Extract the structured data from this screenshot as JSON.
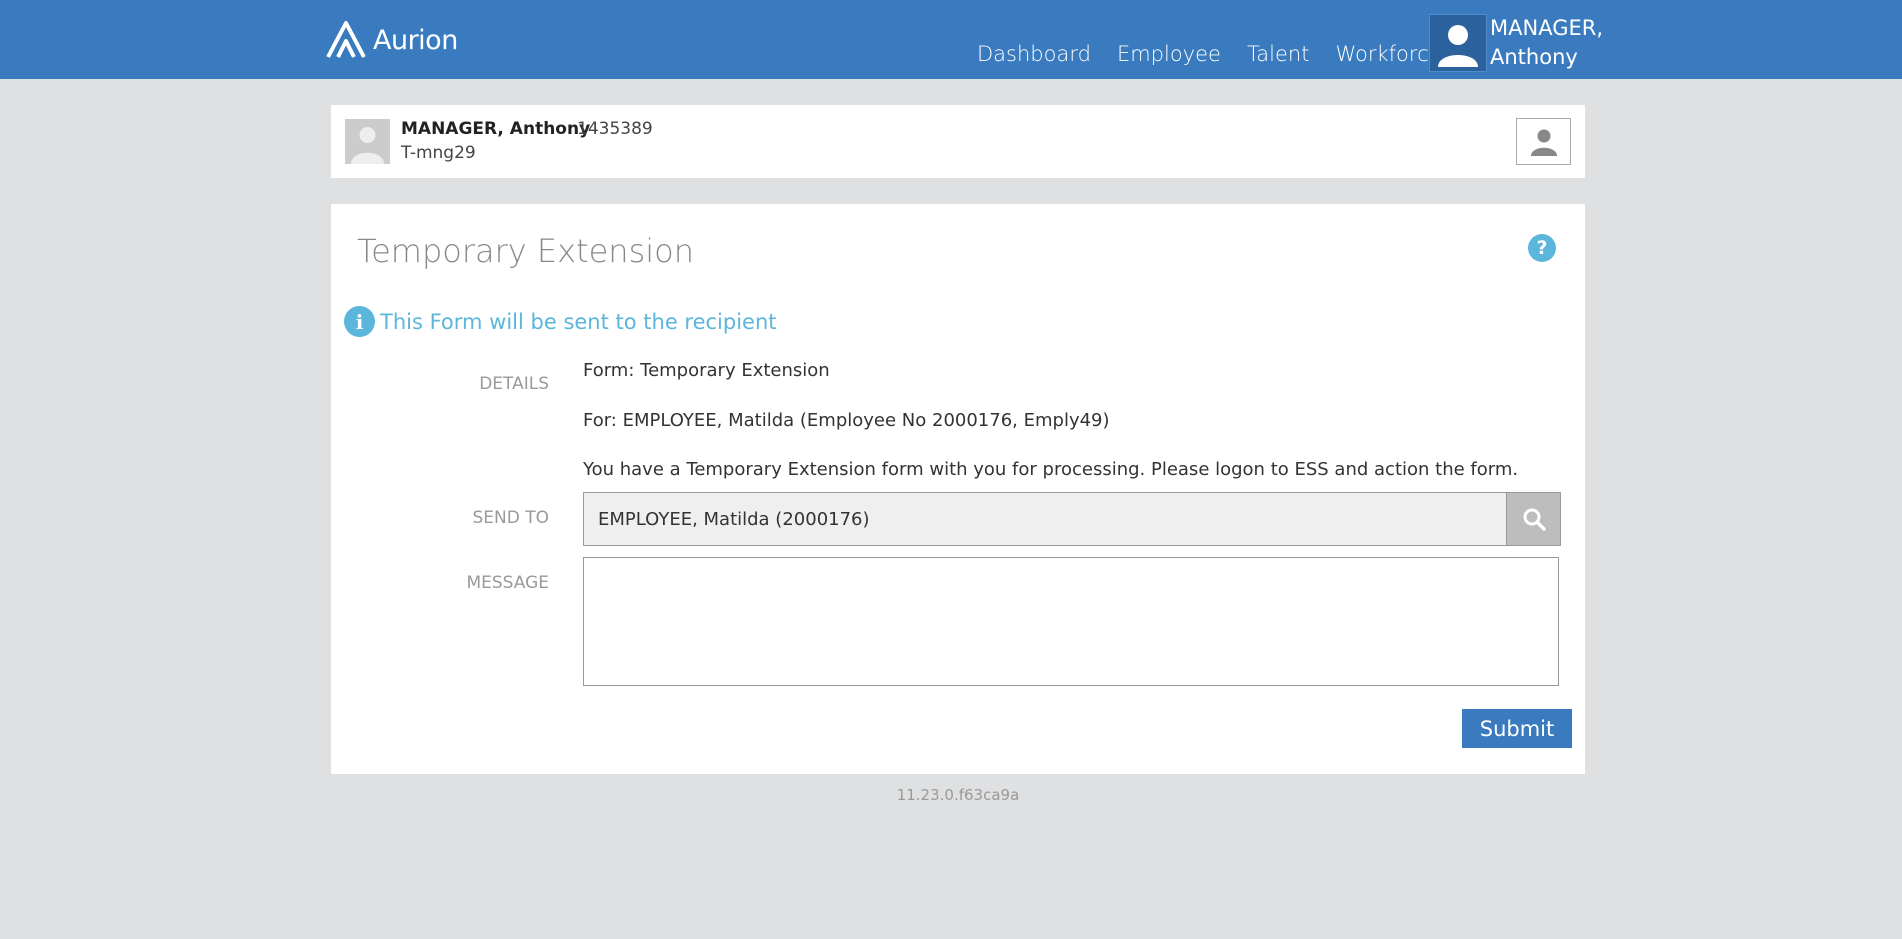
{
  "header": {
    "brand": "Aurion",
    "nav": [
      "Dashboard",
      "Employee",
      "Talent",
      "Workforce"
    ],
    "user_line1": "MANAGER,",
    "user_line2": "Anthony",
    "color": "#3a7bbf"
  },
  "employee": {
    "name": "MANAGER, Anthony",
    "number": "1435389",
    "id": "T-mng29"
  },
  "form": {
    "title": "Temporary Extension",
    "info": "This Form will be sent to the recipient",
    "labels": {
      "details": "DETAILS",
      "send_to": "SEND TO",
      "message": "MESSAGE"
    },
    "details": [
      "Form: Temporary Extension",
      "For: EMPLOYEE, Matilda (Employee No 2000176, Emply49)",
      "You have a Temporary Extension form with you for processing.  Please logon to ESS and action the form."
    ],
    "send_to_value": "EMPLOYEE, Matilda (2000176)",
    "message_value": "",
    "submit_label": "Submit"
  },
  "version": "11.23.0.f63ca9a",
  "icons": [
    "aurion-logo-icon",
    "user-avatar-icon",
    "person-icon",
    "help-icon",
    "info-icon",
    "search-icon"
  ]
}
